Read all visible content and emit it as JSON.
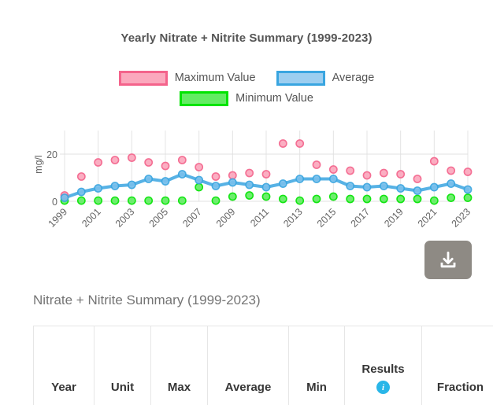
{
  "chart": {
    "title": "Yearly Nitrate + Nitrite Summary (1999-2023)",
    "legend": [
      {
        "label": "Maximum Value",
        "color": "#f4638b",
        "fill": "#fba8bd",
        "icon": "legend-swatch-max"
      },
      {
        "label": "Average",
        "color": "#39a5e0",
        "fill": "#9ccef0",
        "icon": "legend-swatch-avg"
      },
      {
        "label": "Minimum Value",
        "color": "#00e400",
        "fill": "#63ec63",
        "icon": "legend-swatch-min"
      }
    ]
  },
  "chart_data": {
    "type": "scatter",
    "title": "Yearly Nitrate + Nitrite Summary (1999-2023)",
    "xlabel": "",
    "ylabel": "mg/l",
    "ylim": [
      0,
      26
    ],
    "yticks": [
      0,
      20
    ],
    "ytick_labels": [
      "0",
      "20"
    ],
    "grid": true,
    "legend_position": "top",
    "x": [
      1999,
      2000,
      2001,
      2002,
      2003,
      2004,
      2005,
      2006,
      2007,
      2008,
      2009,
      2010,
      2011,
      2012,
      2013,
      2014,
      2015,
      2016,
      2017,
      2018,
      2019,
      2020,
      2021,
      2022,
      2023
    ],
    "xticks": [
      1999,
      2001,
      2003,
      2005,
      2007,
      2009,
      2011,
      2013,
      2015,
      2017,
      2019,
      2021,
      2023
    ],
    "xtick_labels": [
      "1999",
      "2001",
      "2003",
      "2005",
      "2007",
      "2009",
      "2011",
      "2013",
      "2015",
      "2017",
      "2019",
      "2021",
      "2023"
    ],
    "series": [
      {
        "name": "Maximum Value",
        "color": "#f4638b",
        "fill": "#fba8bd",
        "mode": "markers",
        "values": [
          2.5,
          10.5,
          16.5,
          17.5,
          18.5,
          16.5,
          15.0,
          17.5,
          14.5,
          10.5,
          11.0,
          12.0,
          11.5,
          24.5,
          24.5,
          15.5,
          13.5,
          13.0,
          11.0,
          12.0,
          11.5,
          9.5,
          17.0,
          13.0,
          12.5
        ]
      },
      {
        "name": "Average",
        "color": "#39a5e0",
        "fill": "#79c0ec",
        "mode": "lines+markers",
        "values": [
          1.5,
          4.0,
          5.5,
          6.5,
          7.0,
          9.5,
          8.5,
          11.5,
          9.0,
          6.5,
          8.0,
          7.0,
          6.0,
          7.5,
          9.5,
          9.5,
          9.5,
          6.5,
          6.0,
          6.5,
          5.5,
          4.5,
          6.0,
          7.5,
          5.0
        ]
      },
      {
        "name": "Minimum Value",
        "color": "#00e400",
        "fill": "#63ec63",
        "mode": "markers",
        "values": [
          0.3,
          0.3,
          0.3,
          0.3,
          0.3,
          0.3,
          0.3,
          0.3,
          6.0,
          0.3,
          2.0,
          2.5,
          2.0,
          1.0,
          0.3,
          1.0,
          2.0,
          1.0,
          1.0,
          1.0,
          1.0,
          1.0,
          0.3,
          1.5,
          1.5
        ]
      }
    ]
  },
  "download": {
    "icon": "download-icon",
    "tooltip": "Download"
  },
  "table": {
    "caption": "Nitrate + Nitrite Summary (1999-2023)",
    "columns": [
      {
        "label": "Year",
        "key": "year"
      },
      {
        "label": "Unit",
        "key": "unit"
      },
      {
        "label": "Max",
        "key": "max"
      },
      {
        "label": "Average",
        "key": "average"
      },
      {
        "label": "Min",
        "key": "min"
      },
      {
        "label": "Results",
        "key": "results",
        "info_icon": "i"
      },
      {
        "label": "Fraction",
        "key": "fraction"
      }
    ]
  }
}
